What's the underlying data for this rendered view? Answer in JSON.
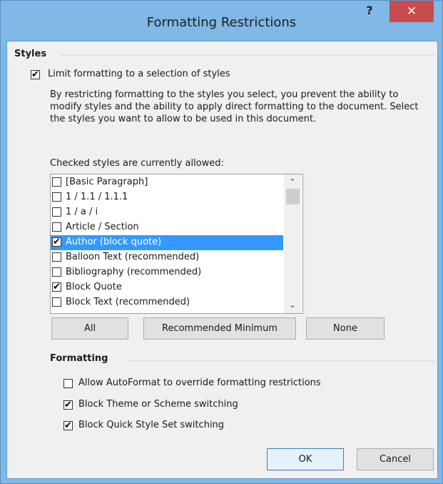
{
  "window": {
    "title": "Formatting Restrictions",
    "help_label": "?",
    "close_label": "✕"
  },
  "styles_section": {
    "title": "Styles",
    "limit_checkbox": {
      "label": "Limit formatting to a selection of styles",
      "checked": true
    },
    "description": "By restricting formatting to the styles you select, you prevent the ability to modify styles and the ability to apply direct formatting to the document. Select the styles you want to allow to be used in this document.",
    "list_caption": "Checked styles are currently allowed:",
    "items": [
      {
        "label": "[Basic Paragraph]",
        "checked": false,
        "selected": false
      },
      {
        "label": "1 / 1.1 / 1.1.1",
        "checked": false,
        "selected": false
      },
      {
        "label": "1 / a / i",
        "checked": false,
        "selected": false
      },
      {
        "label": "Article / Section",
        "checked": false,
        "selected": false
      },
      {
        "label": "Author (block quote)",
        "checked": true,
        "selected": true
      },
      {
        "label": "Balloon Text (recommended)",
        "checked": false,
        "selected": false
      },
      {
        "label": "Bibliography (recommended)",
        "checked": false,
        "selected": false
      },
      {
        "label": "Block Quote",
        "checked": true,
        "selected": false
      },
      {
        "label": "Block Text (recommended)",
        "checked": false,
        "selected": false
      }
    ],
    "buttons": {
      "all": "All",
      "recommended": "Recommended Minimum",
      "none": "None"
    }
  },
  "formatting_section": {
    "title": "Formatting",
    "options": [
      {
        "label": "Allow AutoFormat to override formatting restrictions",
        "checked": false
      },
      {
        "label": "Block Theme or Scheme switching",
        "checked": true
      },
      {
        "label": "Block Quick Style Set switching",
        "checked": true
      }
    ]
  },
  "footer": {
    "ok": "OK",
    "cancel": "Cancel"
  },
  "colors": {
    "title_bar": "#80b8e6",
    "close_button": "#c94c4c",
    "selection": "#3399ff"
  }
}
